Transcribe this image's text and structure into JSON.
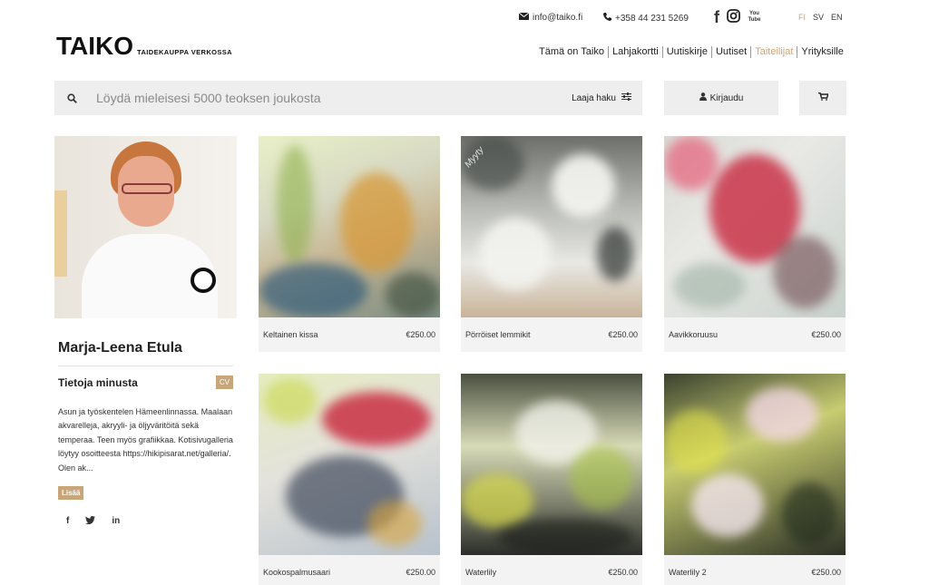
{
  "topbar": {
    "email": "info@taiko.fi",
    "phone": "+358 44 231 5269",
    "social": [
      "facebook-icon",
      "instagram-icon",
      "youtube-icon"
    ],
    "youtube_label": "You Tube",
    "languages": [
      "FI",
      "SV",
      "EN"
    ],
    "active_language": "FI"
  },
  "logo": {
    "brand": "TAIKO",
    "tagline": "TAIDEKAUPPA VERKOSSA"
  },
  "nav": [
    "Tämä on Taiko",
    "Lahjakortti",
    "Uutiskirje",
    "Uutiset",
    "Taiteilijat",
    "Yrityksille"
  ],
  "nav_active": "Taiteilijat",
  "search": {
    "placeholder": "Löydä mieleisesi 5000 teoksen joukosta",
    "advanced": "Laaja haku"
  },
  "login": "Kirjaudu",
  "artist": {
    "name": "Marja-Leena Etula",
    "about_title": "Tietoja minusta",
    "cv": "CV",
    "bio": "Asun ja työskentelen Hämeenlinnassa. Maalaan akvarelleja, akryyli- ja öljyväritöitä sekä temperaa. Teen myös grafiikkaa. Kotisivugalleria löytyy osoitteesta https://hikipisarat.net/galleria/. Olen ak...",
    "more": "Lisää",
    "share_icons": [
      "facebook-icon",
      "twitter-icon",
      "linkedin-icon"
    ]
  },
  "artworks": [
    {
      "title": "Keltainen kissa",
      "price": "€250.00",
      "sold": ""
    },
    {
      "title": "Pörröiset lemmikit",
      "price": "€250.00",
      "sold": "Myyty"
    },
    {
      "title": "Aavikkoruusu",
      "price": "€250.00",
      "sold": ""
    },
    {
      "title": "Kookospalmusaari",
      "price": "€250.00",
      "sold": ""
    },
    {
      "title": "Waterlily",
      "price": "€250.00",
      "sold": ""
    },
    {
      "title": "Waterlily 2",
      "price": "€250.00",
      "sold": ""
    }
  ],
  "colors": {
    "accent": "#c9a57a",
    "panel": "#eeeeee"
  }
}
